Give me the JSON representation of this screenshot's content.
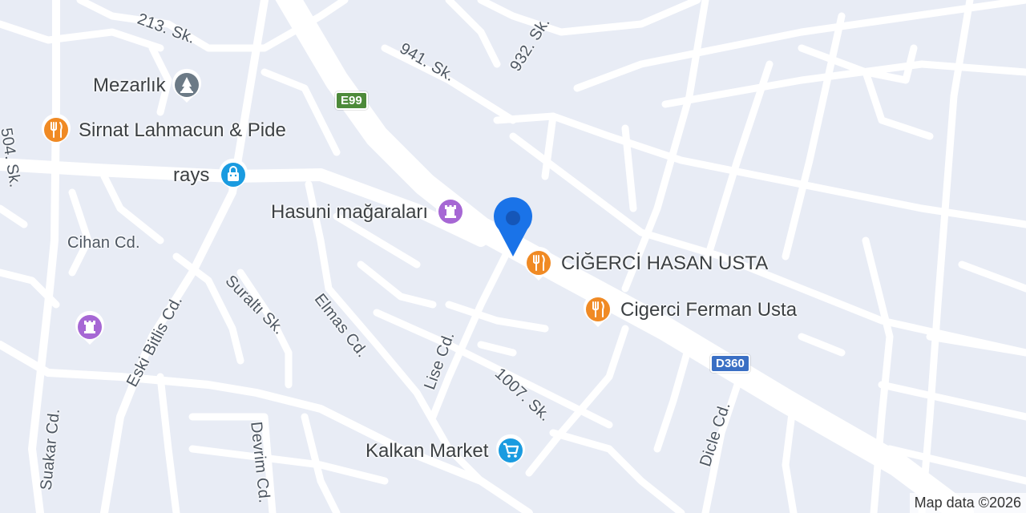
{
  "map": {
    "attribution": "Map data ©2026",
    "streets": [
      {
        "id": "213-sk",
        "name": "213. Sk."
      },
      {
        "id": "504-sk",
        "name": "504. Sk."
      },
      {
        "id": "941-sk",
        "name": "941. Sk."
      },
      {
        "id": "932-sk",
        "name": "932. Sk."
      },
      {
        "id": "cihan-cd",
        "name": "Cihan Cd."
      },
      {
        "id": "eski-bitlis-cd",
        "name": "Eski Bitlis Cd."
      },
      {
        "id": "suralti-sk",
        "name": "Suraltı Sk."
      },
      {
        "id": "elmas-cd",
        "name": "Elmas Cd."
      },
      {
        "id": "lise-cd",
        "name": "Lise Cd."
      },
      {
        "id": "1007-sk",
        "name": "1007. Sk."
      },
      {
        "id": "dicle-cd",
        "name": "Dicle Cd."
      },
      {
        "id": "suakar-cd",
        "name": "Suakar Cd."
      },
      {
        "id": "devrim-cd",
        "name": "Devrim Cd."
      }
    ],
    "route_shields": [
      {
        "id": "e99",
        "label": "E99",
        "color": "#4d8a3a"
      },
      {
        "id": "d360",
        "label": "D360",
        "color": "#3a6fc4"
      }
    ],
    "pois": [
      {
        "id": "mezarlik",
        "name": "Mezarlık",
        "icon": "cemetery-icon",
        "color": "#6c7a86"
      },
      {
        "id": "sirnat",
        "name": "Sirnat Lahmacun & Pide",
        "icon": "restaurant-icon",
        "color": "#f08a24"
      },
      {
        "id": "rays",
        "name": "rays",
        "icon": "shopping-bag-icon",
        "color": "#1a9be0"
      },
      {
        "id": "hasuni",
        "name": "Hasuni mağaraları",
        "icon": "landmark-icon",
        "color": "#a667d4"
      },
      {
        "id": "cigerci-hasan",
        "name": "CİĞERCİ HASAN USTA",
        "icon": "restaurant-icon",
        "color": "#f08a24"
      },
      {
        "id": "cigerci-ferman",
        "name": "Cigerci Ferman Usta",
        "icon": "restaurant-icon",
        "color": "#f08a24"
      },
      {
        "id": "kalkan",
        "name": "Kalkan Market",
        "icon": "shopping-cart-icon",
        "color": "#1a9be0"
      },
      {
        "id": "landmark-unnamed",
        "name": "",
        "icon": "landmark-icon",
        "color": "#a667d4"
      }
    ],
    "current_location": {
      "icon": "location-pin-icon",
      "color": "#1a73e8"
    }
  }
}
